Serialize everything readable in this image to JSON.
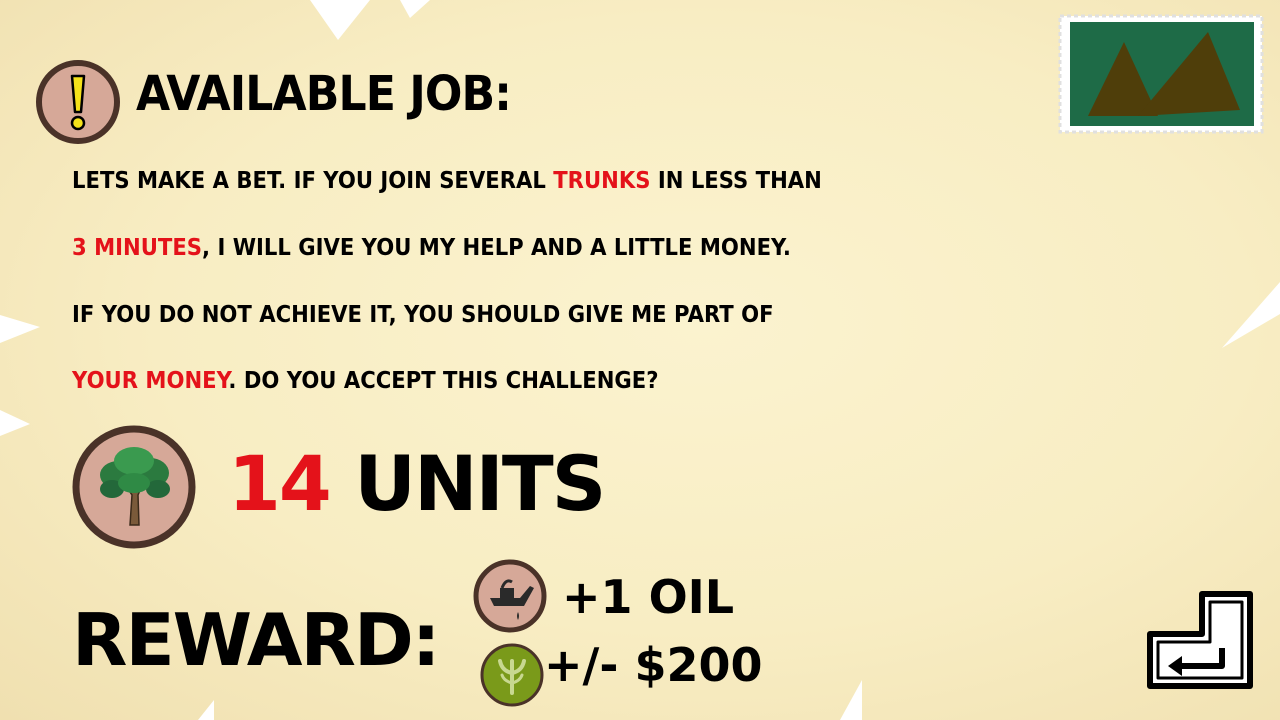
{
  "header": {
    "icon": "exclamation-icon",
    "title": "AVAILABLE JOB:"
  },
  "stamp": {
    "icon": "mountain-stamp-icon",
    "colors": {
      "background": "#1e6b47",
      "mountain": "#4f3e0a",
      "border": "#ffffff"
    }
  },
  "description": {
    "line1": {
      "pre": "LETS MAKE A BET. IF YOU JOIN SEVERAL ",
      "highlight": "TRUNKS",
      "post": " IN LESS THAN"
    },
    "line2": {
      "highlight": "3 MINUTES",
      "post": ", I WILL GIVE YOU MY HELP AND A LITTLE MONEY."
    },
    "line3": {
      "text": "IF YOU DO NOT ACHIEVE IT, YOU SHOULD GIVE ME PART OF"
    },
    "line4": {
      "highlight": "YOUR MONEY",
      "post": ". DO YOU ACCEPT THIS CHALLENGE?"
    }
  },
  "requirement": {
    "icon": "tree-icon",
    "amount": "14",
    "unit": "UNITS"
  },
  "reward": {
    "label": "REWARD:",
    "items": [
      {
        "icon": "oil-can-icon",
        "text": "+1 OIL"
      },
      {
        "icon": "money-sprout-icon",
        "text": "+/- $200"
      }
    ]
  },
  "controls": {
    "accept_icon": "enter-key-icon"
  },
  "colors": {
    "highlight": "#e4121a",
    "badge_fill": "#d6a898",
    "badge_ring": "#4a3228",
    "money_badge": "#7a9a1a",
    "paper": "#f8edc3"
  }
}
